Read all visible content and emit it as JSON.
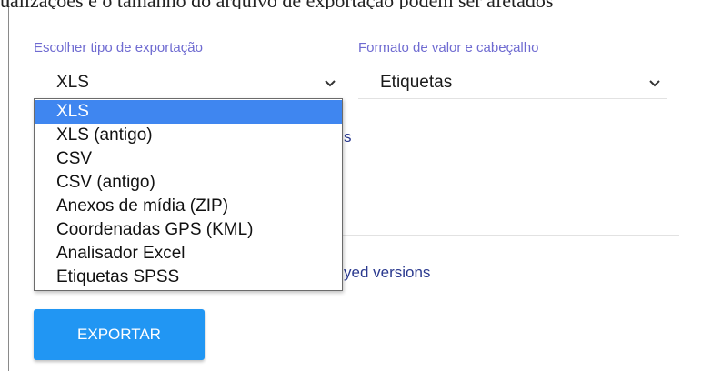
{
  "top_cut_text": "ualizações e o tamanho do arquivo de exportação podem ser afetados",
  "export_type": {
    "label": "Escolher tipo de exportação",
    "selected": "XLS",
    "options": [
      "XLS",
      "XLS (antigo)",
      "CSV",
      "CSV (antigo)",
      "Anexos de mídia (ZIP)",
      "Coordenadas GPS (KML)",
      "Analisador Excel",
      "Etiquetas SPSS"
    ]
  },
  "value_format": {
    "label": "Formato de valor e cabeçalho",
    "selected": "Etiquetas"
  },
  "partial_text_1": "s",
  "partial_text_2": "yed versions",
  "export_button": "EXPORTAR",
  "icons": {
    "select_chevron": "chevron-down-icon"
  }
}
